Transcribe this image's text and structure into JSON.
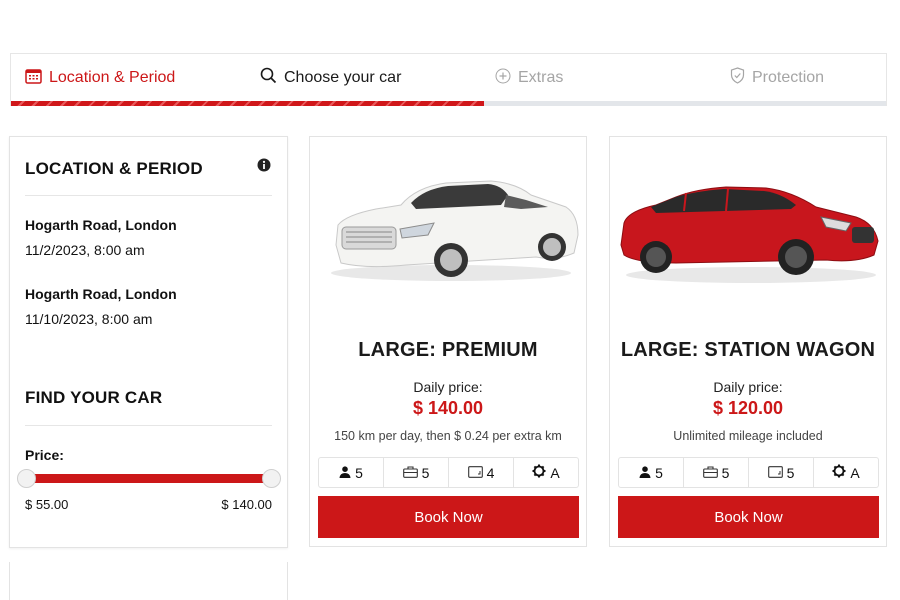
{
  "steps": [
    {
      "label": "Location & Period",
      "icon": "calendar-icon",
      "state": "completed"
    },
    {
      "label": "Choose your car",
      "icon": "search-icon",
      "state": "active"
    },
    {
      "label": "Extras",
      "icon": "plus-circle-icon",
      "state": "pending"
    },
    {
      "label": "Protection",
      "icon": "shield-check-icon",
      "state": "pending"
    }
  ],
  "progress": {
    "percent": 54
  },
  "sidebar": {
    "location_title": "LOCATION & PERIOD",
    "pickup": {
      "location": "Hogarth Road, London",
      "datetime": "11/2/2023, 8:00 am"
    },
    "dropoff": {
      "location": "Hogarth Road, London",
      "datetime": "11/10/2023, 8:00 am"
    },
    "find_title": "FIND YOUR CAR",
    "price_label": "Price:",
    "price_min": "$ 55.00",
    "price_max": "$ 140.00",
    "slider": {
      "min_value": 55,
      "max_value": 140,
      "selected_min": 55,
      "selected_max": 140
    }
  },
  "cars": [
    {
      "title": "LARGE: PREMIUM",
      "daily_label": "Daily price:",
      "price": "$ 140.00",
      "mileage": "150 km per day, then $ 0.24 per extra km",
      "specs": {
        "seats": "5",
        "bags": "5",
        "doors": "4",
        "transmission": "A"
      },
      "button": "Book Now",
      "color": "white"
    },
    {
      "title": "LARGE: STATION WAGON",
      "daily_label": "Daily price:",
      "price": "$ 120.00",
      "mileage": "Unlimited mileage included",
      "specs": {
        "seats": "5",
        "bags": "5",
        "doors": "5",
        "transmission": "A"
      },
      "button": "Book Now",
      "color": "red"
    }
  ],
  "colors": {
    "accent": "#cc1718",
    "muted": "#a5a5a5",
    "border": "#e3e3e3"
  }
}
